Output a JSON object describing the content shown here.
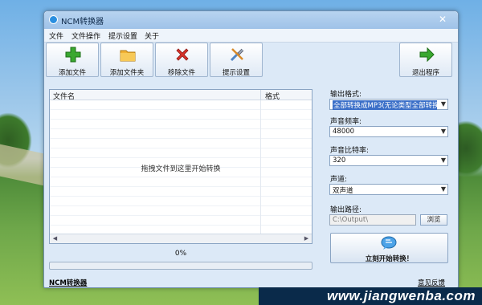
{
  "window": {
    "title": "NCM转换器",
    "close_symbol": "✕"
  },
  "menu": [
    "文件",
    "文件操作",
    "提示设置",
    "关于"
  ],
  "toolbar": {
    "add_file": "添加文件",
    "add_folder": "添加文件夹",
    "remove_file": "移除文件",
    "tip_settings": "提示设置",
    "exit": "退出程序"
  },
  "file_list": {
    "col_name": "文件名",
    "col_format": "格式",
    "hint": "拖拽文件到这里开始转换"
  },
  "progress": {
    "text": "0%",
    "value": 0
  },
  "settings": {
    "output_format_label": "输出格式:",
    "output_format_value": "全部转换成MP3(无论类型全部转换",
    "sample_rate_label": "声音频率:",
    "sample_rate_value": "48000",
    "bitrate_label": "声音比特率:",
    "bitrate_value": "320",
    "channel_label": "声道:",
    "channel_value": "双声道",
    "output_path_label": "输出路径:",
    "output_path_value": "C:\\Output\\",
    "browse_label": "浏览"
  },
  "start_button": "立刻开始转换！",
  "footer": {
    "left": "NCM转换器",
    "right": "意见反馈"
  },
  "watermark": "www.jiangwenba.com",
  "colors": {
    "add": "#3aa830",
    "folder": "#f2b233",
    "remove": "#d8322a",
    "tools": "#4f86c6",
    "exit": "#3aa830"
  }
}
